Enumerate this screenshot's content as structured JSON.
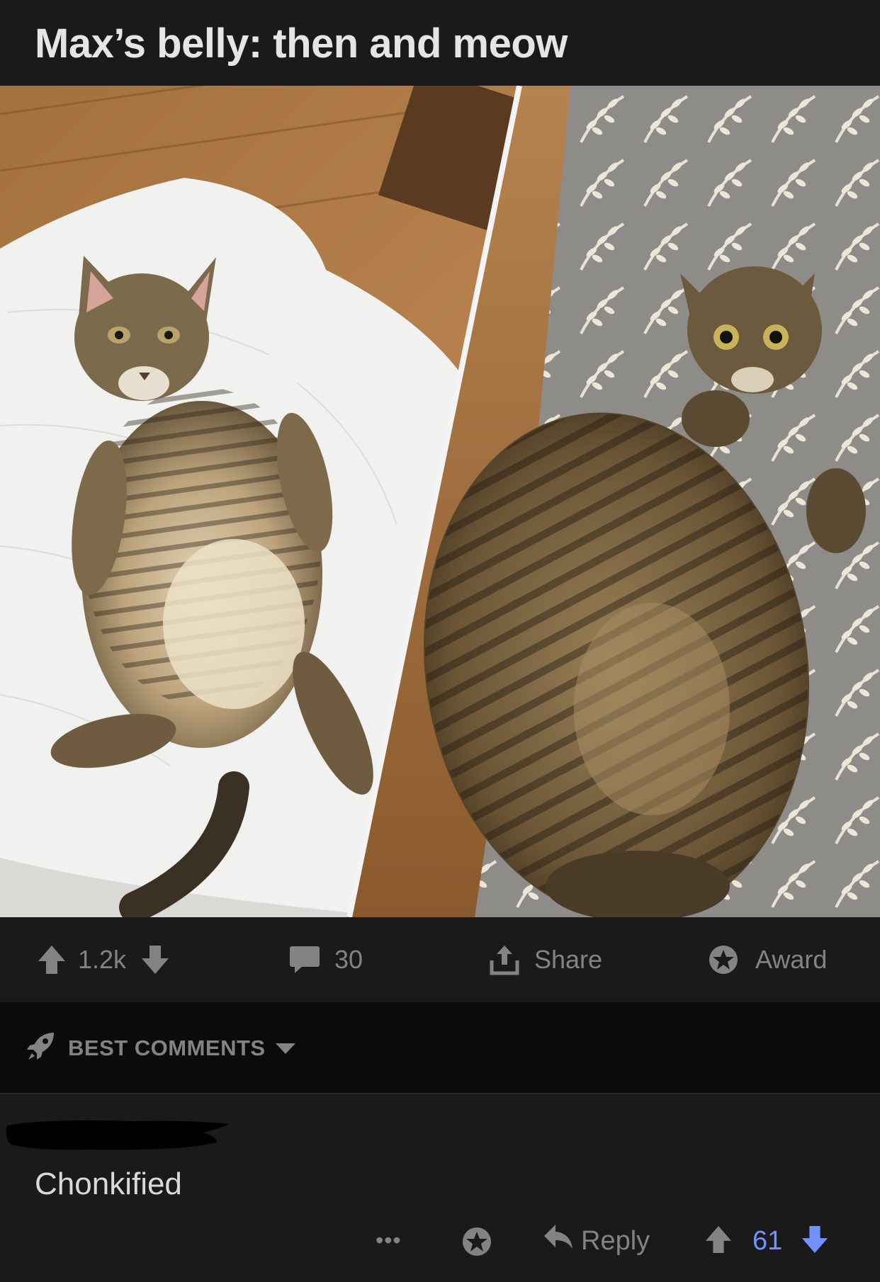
{
  "post": {
    "title": "Max’s belly: then and meow",
    "image_alt": "Two side-by-side photos of a tabby cat lying belly-up: thin kitten on a white blanket (left) and a much chubbier adult cat on a patterned rug (right)"
  },
  "actions": {
    "upvote_icon": "arrow-up-icon",
    "score": "1.2k",
    "downvote_icon": "arrow-down-icon",
    "comments_icon": "comment-bubble-icon",
    "comments_count": "30",
    "share_icon": "share-upload-icon",
    "share_label": "Share",
    "award_icon": "award-star-icon",
    "award_label": "Award"
  },
  "sort": {
    "icon": "rocket-icon",
    "label": "BEST COMMENTS",
    "chevron": "caret-down-icon"
  },
  "comment": {
    "author_redacted": true,
    "body": "Chonkified",
    "more_label": "•••",
    "award_icon": "award-star-icon",
    "reply_icon": "reply-arrow-icon",
    "reply_label": "Reply",
    "score": "61",
    "score_color": "#7193ff"
  },
  "colors": {
    "background": "#1a1a1b",
    "sort_bar": "#0b0b0c",
    "muted_text": "#818384",
    "vote_blue": "#7193ff"
  }
}
